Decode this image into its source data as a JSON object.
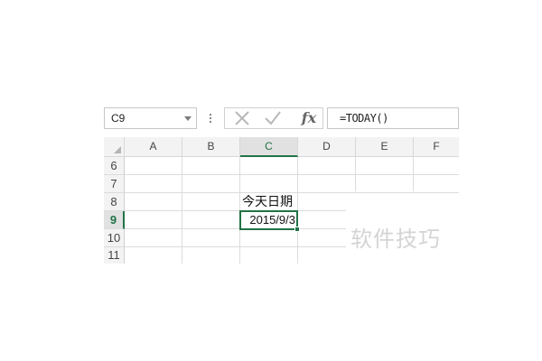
{
  "formula_bar": {
    "name_box": "C9",
    "cancel_icon": "cancel-x-icon",
    "enter_icon": "checkmark-icon",
    "function_icon": "fx",
    "formula": "=TODAY()"
  },
  "columns": [
    "A",
    "B",
    "C",
    "D",
    "E",
    "F"
  ],
  "selected_column": "C",
  "rows": [
    "6",
    "7",
    "8",
    "9",
    "10",
    "11"
  ],
  "selected_row": "9",
  "cells": {
    "C8": "今天日期",
    "C9": "2015/9/3"
  },
  "watermark": "软件技巧",
  "colors": {
    "accent": "#217346",
    "header_bg": "#f3f3f3",
    "gridline": "#dcdcdc"
  }
}
